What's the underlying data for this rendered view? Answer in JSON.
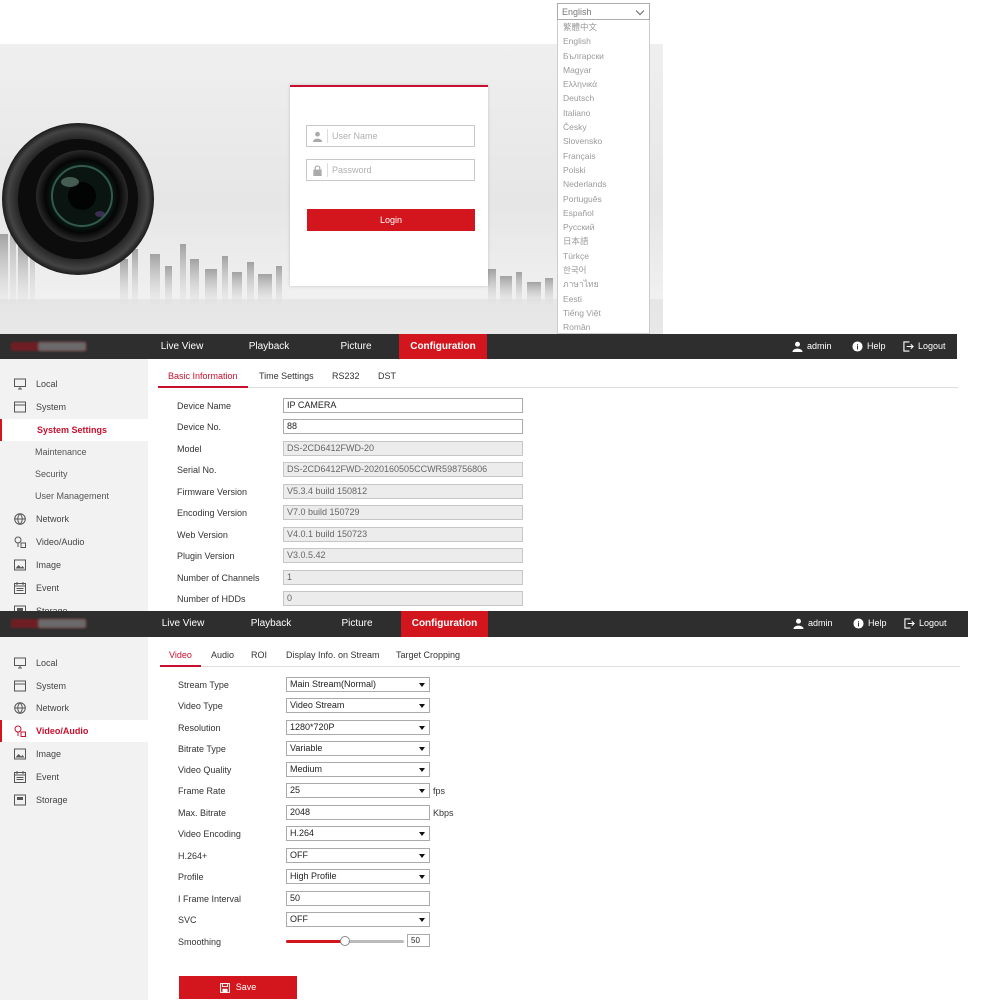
{
  "login": {
    "username_placeholder": "User Name",
    "password_placeholder": "Password",
    "login_label": "Login",
    "language_selected": "English",
    "languages": [
      "繁體中文",
      "English",
      "Български",
      "Magyar",
      "Ελληνικά",
      "Deutsch",
      "Italiano",
      "Česky",
      "Slovensko",
      "Français",
      "Polski",
      "Nederlands",
      "Português",
      "Español",
      "Русский",
      "日本語",
      "Türkçe",
      "한국어",
      "ภาษาไทย",
      "Eesti",
      "Tiếng Việt",
      "Român"
    ],
    "accent_color": "#d3161e"
  },
  "nav": {
    "live_view": "Live View",
    "playback": "Playback",
    "picture": "Picture",
    "configuration": "Configuration",
    "user": "admin",
    "help": "Help",
    "logout": "Logout",
    "bar_color": "#2e2e2e"
  },
  "system_page": {
    "sidebar": {
      "local": "Local",
      "system": "System",
      "system_settings": "System Settings",
      "maintenance": "Maintenance",
      "security": "Security",
      "user_management": "User Management",
      "network": "Network",
      "video_audio": "Video/Audio",
      "image": "Image",
      "event": "Event",
      "storage": "Storage"
    },
    "tabs": [
      "Basic Information",
      "Time Settings",
      "RS232",
      "DST"
    ],
    "fields": [
      {
        "label": "Device Name",
        "value": "IP CAMERA"
      },
      {
        "label": "Device No.",
        "value": "88"
      },
      {
        "label": "Model",
        "value": "DS-2CD6412FWD-20"
      },
      {
        "label": "Serial No.",
        "value": "DS-2CD6412FWD-2020160505CCWR598756806"
      },
      {
        "label": "Firmware Version",
        "value": "V5.3.4 build 150812"
      },
      {
        "label": "Encoding Version",
        "value": "V7.0 build 150729"
      },
      {
        "label": "Web Version",
        "value": "V4.0.1 build 150723"
      },
      {
        "label": "Plugin Version",
        "value": "V3.0.5.42"
      },
      {
        "label": "Number of Channels",
        "value": "1"
      },
      {
        "label": "Number of HDDs",
        "value": "0"
      }
    ]
  },
  "video_page": {
    "sidebar": {
      "local": "Local",
      "system": "System",
      "network": "Network",
      "video_audio": "Video/Audio",
      "image": "Image",
      "event": "Event",
      "storage": "Storage"
    },
    "tabs": [
      "Video",
      "Audio",
      "ROI",
      "Display Info. on Stream",
      "Target Cropping"
    ],
    "fields": [
      {
        "label": "Stream Type",
        "value": "Main Stream(Normal)",
        "kind": "select"
      },
      {
        "label": "Video Type",
        "value": "Video Stream",
        "kind": "select"
      },
      {
        "label": "Resolution",
        "value": "1280*720P",
        "kind": "select"
      },
      {
        "label": "Bitrate Type",
        "value": "Variable",
        "kind": "select"
      },
      {
        "label": "Video Quality",
        "value": "Medium",
        "kind": "select"
      },
      {
        "label": "Frame Rate",
        "value": "25",
        "kind": "select",
        "unit": "fps"
      },
      {
        "label": "Max. Bitrate",
        "value": "2048",
        "kind": "input",
        "unit": "Kbps"
      },
      {
        "label": "Video Encoding",
        "value": "H.264",
        "kind": "select"
      },
      {
        "label": "H.264+",
        "value": "OFF",
        "kind": "select"
      },
      {
        "label": "Profile",
        "value": "High Profile",
        "kind": "select"
      },
      {
        "label": "I Frame Interval",
        "value": "50",
        "kind": "input"
      },
      {
        "label": "SVC",
        "value": "OFF",
        "kind": "select"
      }
    ],
    "smoothing_label": "Smoothing",
    "smoothing_value": "50",
    "smoothing_fraction": 0.5,
    "save_label": "Save"
  }
}
